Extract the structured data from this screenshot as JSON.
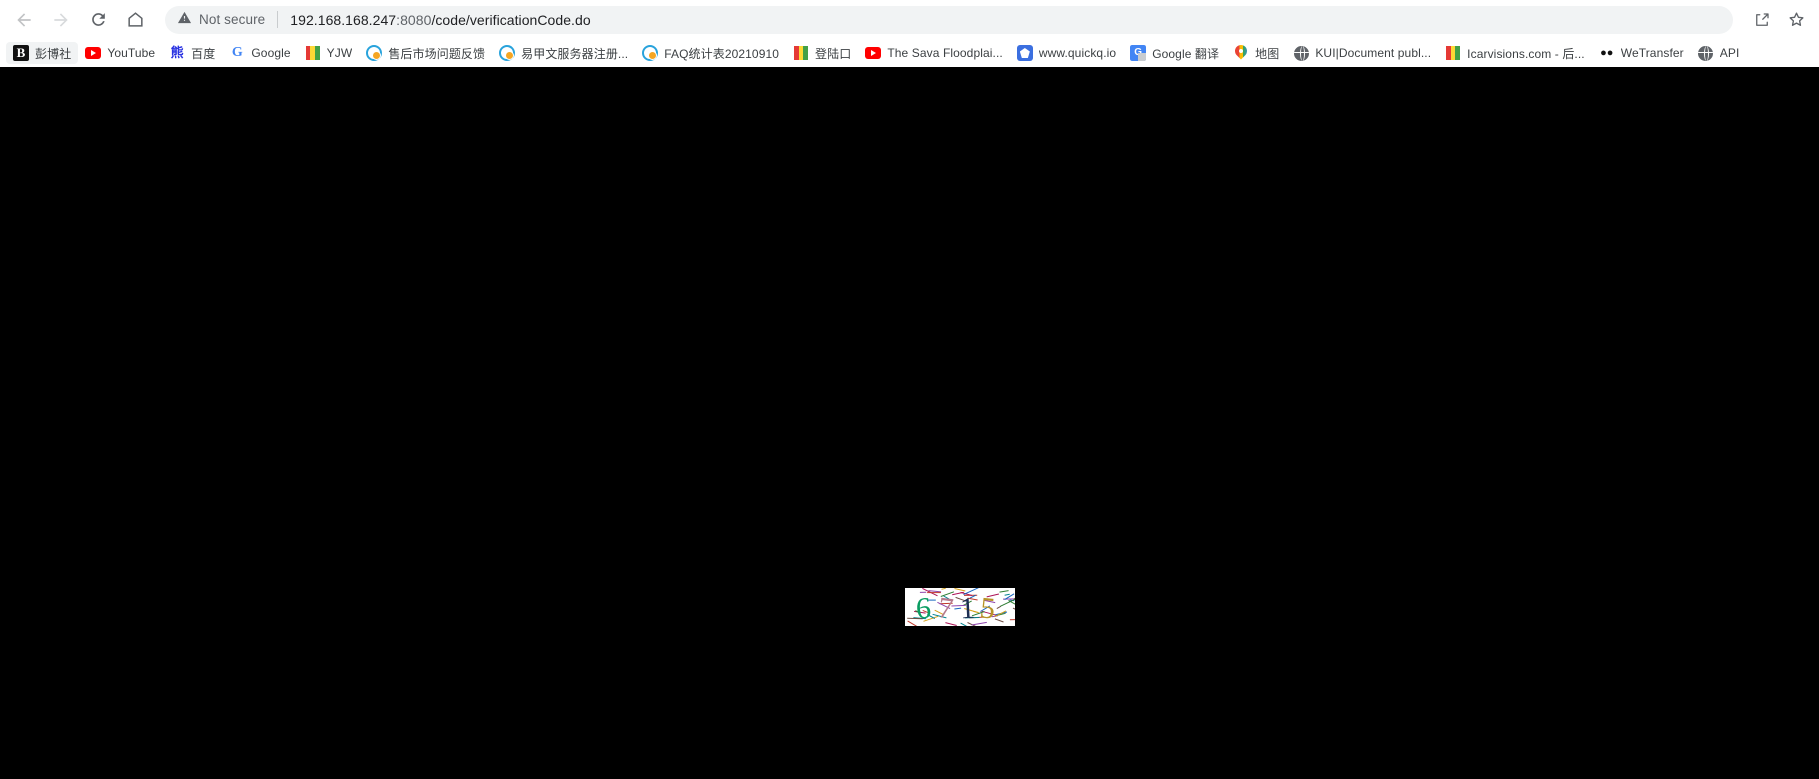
{
  "browser": {
    "nav": {
      "back_icon": "arrow-left-icon",
      "forward_icon": "arrow-right-icon",
      "reload_icon": "reload-icon",
      "home_icon": "home-icon"
    },
    "omnibox": {
      "security_icon": "warning-triangle-icon",
      "security_text": "Not secure",
      "url": "192.168.168.247:8080/code/verificationCode.do",
      "url_host": "192.168.168.247",
      "url_port": ":8080",
      "url_path": "/code/verificationCode.do"
    },
    "actions": [
      {
        "name": "share-icon",
        "label": "Share"
      },
      {
        "name": "bookmark-star-icon",
        "label": "Bookmark this tab"
      }
    ],
    "bookmarks": [
      {
        "label": "彭博社",
        "icon": "bloomberg-favicon",
        "active": true
      },
      {
        "label": "YouTube",
        "icon": "youtube-favicon",
        "active": false
      },
      {
        "label": "百度",
        "icon": "baidu-favicon",
        "active": false
      },
      {
        "label": "Google",
        "icon": "google-favicon",
        "active": false
      },
      {
        "label": "YJW",
        "icon": "stripe-favicon",
        "active": false
      },
      {
        "label": "售后市场问题反馈",
        "icon": "chat-favicon",
        "active": false
      },
      {
        "label": "易甲文服务器注册...",
        "icon": "chat-favicon",
        "active": false
      },
      {
        "label": "FAQ统计表20210910",
        "icon": "chat-favicon",
        "active": false
      },
      {
        "label": "登陆口",
        "icon": "stripe-favicon",
        "active": false
      },
      {
        "label": "The Sava Floodplai...",
        "icon": "youtube-favicon",
        "active": false
      },
      {
        "label": "www.quickq.io",
        "icon": "quickq-favicon",
        "active": false
      },
      {
        "label": "Google 翻译",
        "icon": "google-translate-favicon",
        "active": false
      },
      {
        "label": "地图",
        "icon": "map-pin-favicon",
        "active": false
      },
      {
        "label": "KUI|Document publ...",
        "icon": "globe-favicon",
        "active": false
      },
      {
        "label": "Icarvisions.com - 后...",
        "icon": "stripe-favicon",
        "active": false
      },
      {
        "label": "WeTransfer",
        "icon": "wetransfer-favicon",
        "active": false
      },
      {
        "label": "API",
        "icon": "globe-favicon",
        "active": false
      }
    ]
  },
  "page": {
    "background_color": "#000000",
    "captcha": {
      "name": "verification-code-image",
      "code": "6715",
      "alt": "verification code image",
      "width": 110,
      "height": 38,
      "background_color": "#ffffff",
      "digits": [
        {
          "char": "6",
          "color": "#0a9d62"
        },
        {
          "char": "7",
          "color": "#b57a8e"
        },
        {
          "char": "1",
          "color": "#1c2e52"
        },
        {
          "char": "5",
          "color": "#b79327"
        }
      ],
      "noise_colors": [
        "#8e44ad",
        "#2e7d32",
        "#c0392b",
        "#1565c0",
        "#d4a017",
        "#00838f",
        "#6d4c41",
        "#ad1457"
      ]
    }
  }
}
